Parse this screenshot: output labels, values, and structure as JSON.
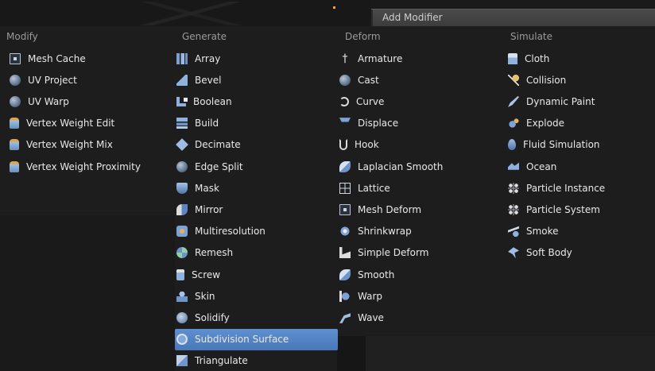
{
  "window": {
    "title": "Add Modifier"
  },
  "columns": [
    {
      "heading": "Modify",
      "items": [
        {
          "label": "Mesh Cache",
          "icon": "mesh-cache-icon",
          "cls": "box"
        },
        {
          "label": "UV Project",
          "icon": "uv-project-icon",
          "cls": "sphere"
        },
        {
          "label": "UV Warp",
          "icon": "uv-warp-icon",
          "cls": "sphere"
        },
        {
          "label": "Vertex Weight Edit",
          "icon": "vertex-weight-edit-icon",
          "cls": "bottle"
        },
        {
          "label": "Vertex Weight Mix",
          "icon": "vertex-weight-mix-icon",
          "cls": "bottle"
        },
        {
          "label": "Vertex Weight Proximity",
          "icon": "vertex-weight-proximity-icon",
          "cls": "bottle"
        }
      ]
    },
    {
      "heading": "Generate",
      "items": [
        {
          "label": "Array",
          "icon": "array-icon",
          "cls": "bars"
        },
        {
          "label": "Bevel",
          "icon": "bevel-icon",
          "cls": "wedge"
        },
        {
          "label": "Boolean",
          "icon": "boolean-icon",
          "cls": "corner"
        },
        {
          "label": "Build",
          "icon": "build-icon",
          "cls": "stack"
        },
        {
          "label": "Decimate",
          "icon": "decimate-icon",
          "cls": "diamond"
        },
        {
          "label": "Edge Split",
          "icon": "edge-split-icon",
          "cls": "sphere"
        },
        {
          "label": "Mask",
          "icon": "mask-icon",
          "cls": "shield"
        },
        {
          "label": "Mirror",
          "icon": "mirror-icon",
          "cls": "mirror"
        },
        {
          "label": "Multiresolution",
          "icon": "multiresolution-icon",
          "cls": "multi"
        },
        {
          "label": "Remesh",
          "icon": "remesh-icon",
          "cls": "remesh"
        },
        {
          "label": "Screw",
          "icon": "screw-icon",
          "cls": "screw"
        },
        {
          "label": "Skin",
          "icon": "skin-icon",
          "cls": "skin"
        },
        {
          "label": "Solidify",
          "icon": "solidify-icon",
          "cls": "solid"
        },
        {
          "label": "Subdivision Surface",
          "icon": "subdivision-surface-icon",
          "cls": "subd",
          "active": true
        },
        {
          "label": "Triangulate",
          "icon": "triangulate-icon",
          "cls": "tri"
        }
      ]
    },
    {
      "heading": "Deform",
      "items": [
        {
          "label": "Armature",
          "icon": "armature-icon",
          "cls": "arm",
          "glyph": "†"
        },
        {
          "label": "Cast",
          "icon": "cast-icon",
          "cls": "sphere"
        },
        {
          "label": "Curve",
          "icon": "curve-icon",
          "cls": "curve"
        },
        {
          "label": "Displace",
          "icon": "displace-icon",
          "cls": "displace"
        },
        {
          "label": "Hook",
          "icon": "hook-icon",
          "cls": "hook"
        },
        {
          "label": "Laplacian Smooth",
          "icon": "laplacian-smooth-icon",
          "cls": "lap"
        },
        {
          "label": "Lattice",
          "icon": "lattice-icon",
          "cls": "lattice"
        },
        {
          "label": "Mesh Deform",
          "icon": "mesh-deform-icon",
          "cls": "box"
        },
        {
          "label": "Shrinkwrap",
          "icon": "shrinkwrap-icon",
          "cls": "shrink"
        },
        {
          "label": "Simple Deform",
          "icon": "simple-deform-icon",
          "cls": "simple"
        },
        {
          "label": "Smooth",
          "icon": "smooth-icon",
          "cls": "lap"
        },
        {
          "label": "Warp",
          "icon": "warp-icon",
          "cls": "warp"
        },
        {
          "label": "Wave",
          "icon": "wave-icon",
          "cls": "wave"
        }
      ]
    },
    {
      "heading": "Simulate",
      "items": [
        {
          "label": "Cloth",
          "icon": "cloth-icon",
          "cls": "cloth"
        },
        {
          "label": "Collision",
          "icon": "collision-icon",
          "cls": "coll"
        },
        {
          "label": "Dynamic Paint",
          "icon": "dynamic-paint-icon",
          "cls": "dyn"
        },
        {
          "label": "Explode",
          "icon": "explode-icon",
          "cls": "explode"
        },
        {
          "label": "Fluid Simulation",
          "icon": "fluid-simulation-icon",
          "cls": "fluid"
        },
        {
          "label": "Ocean",
          "icon": "ocean-icon",
          "cls": "ocean"
        },
        {
          "label": "Particle Instance",
          "icon": "particle-instance-icon",
          "cls": "part"
        },
        {
          "label": "Particle System",
          "icon": "particle-system-icon",
          "cls": "part"
        },
        {
          "label": "Smoke",
          "icon": "smoke-icon",
          "cls": "smoke"
        },
        {
          "label": "Soft Body",
          "icon": "soft-body-icon",
          "cls": "soft"
        }
      ]
    }
  ],
  "colors": {
    "panel": "#1d1d1d",
    "highlight": "#5b8ad0",
    "text": "#e8e8e8",
    "heading": "#9a9a9a",
    "accent": "#ff9c3a"
  }
}
